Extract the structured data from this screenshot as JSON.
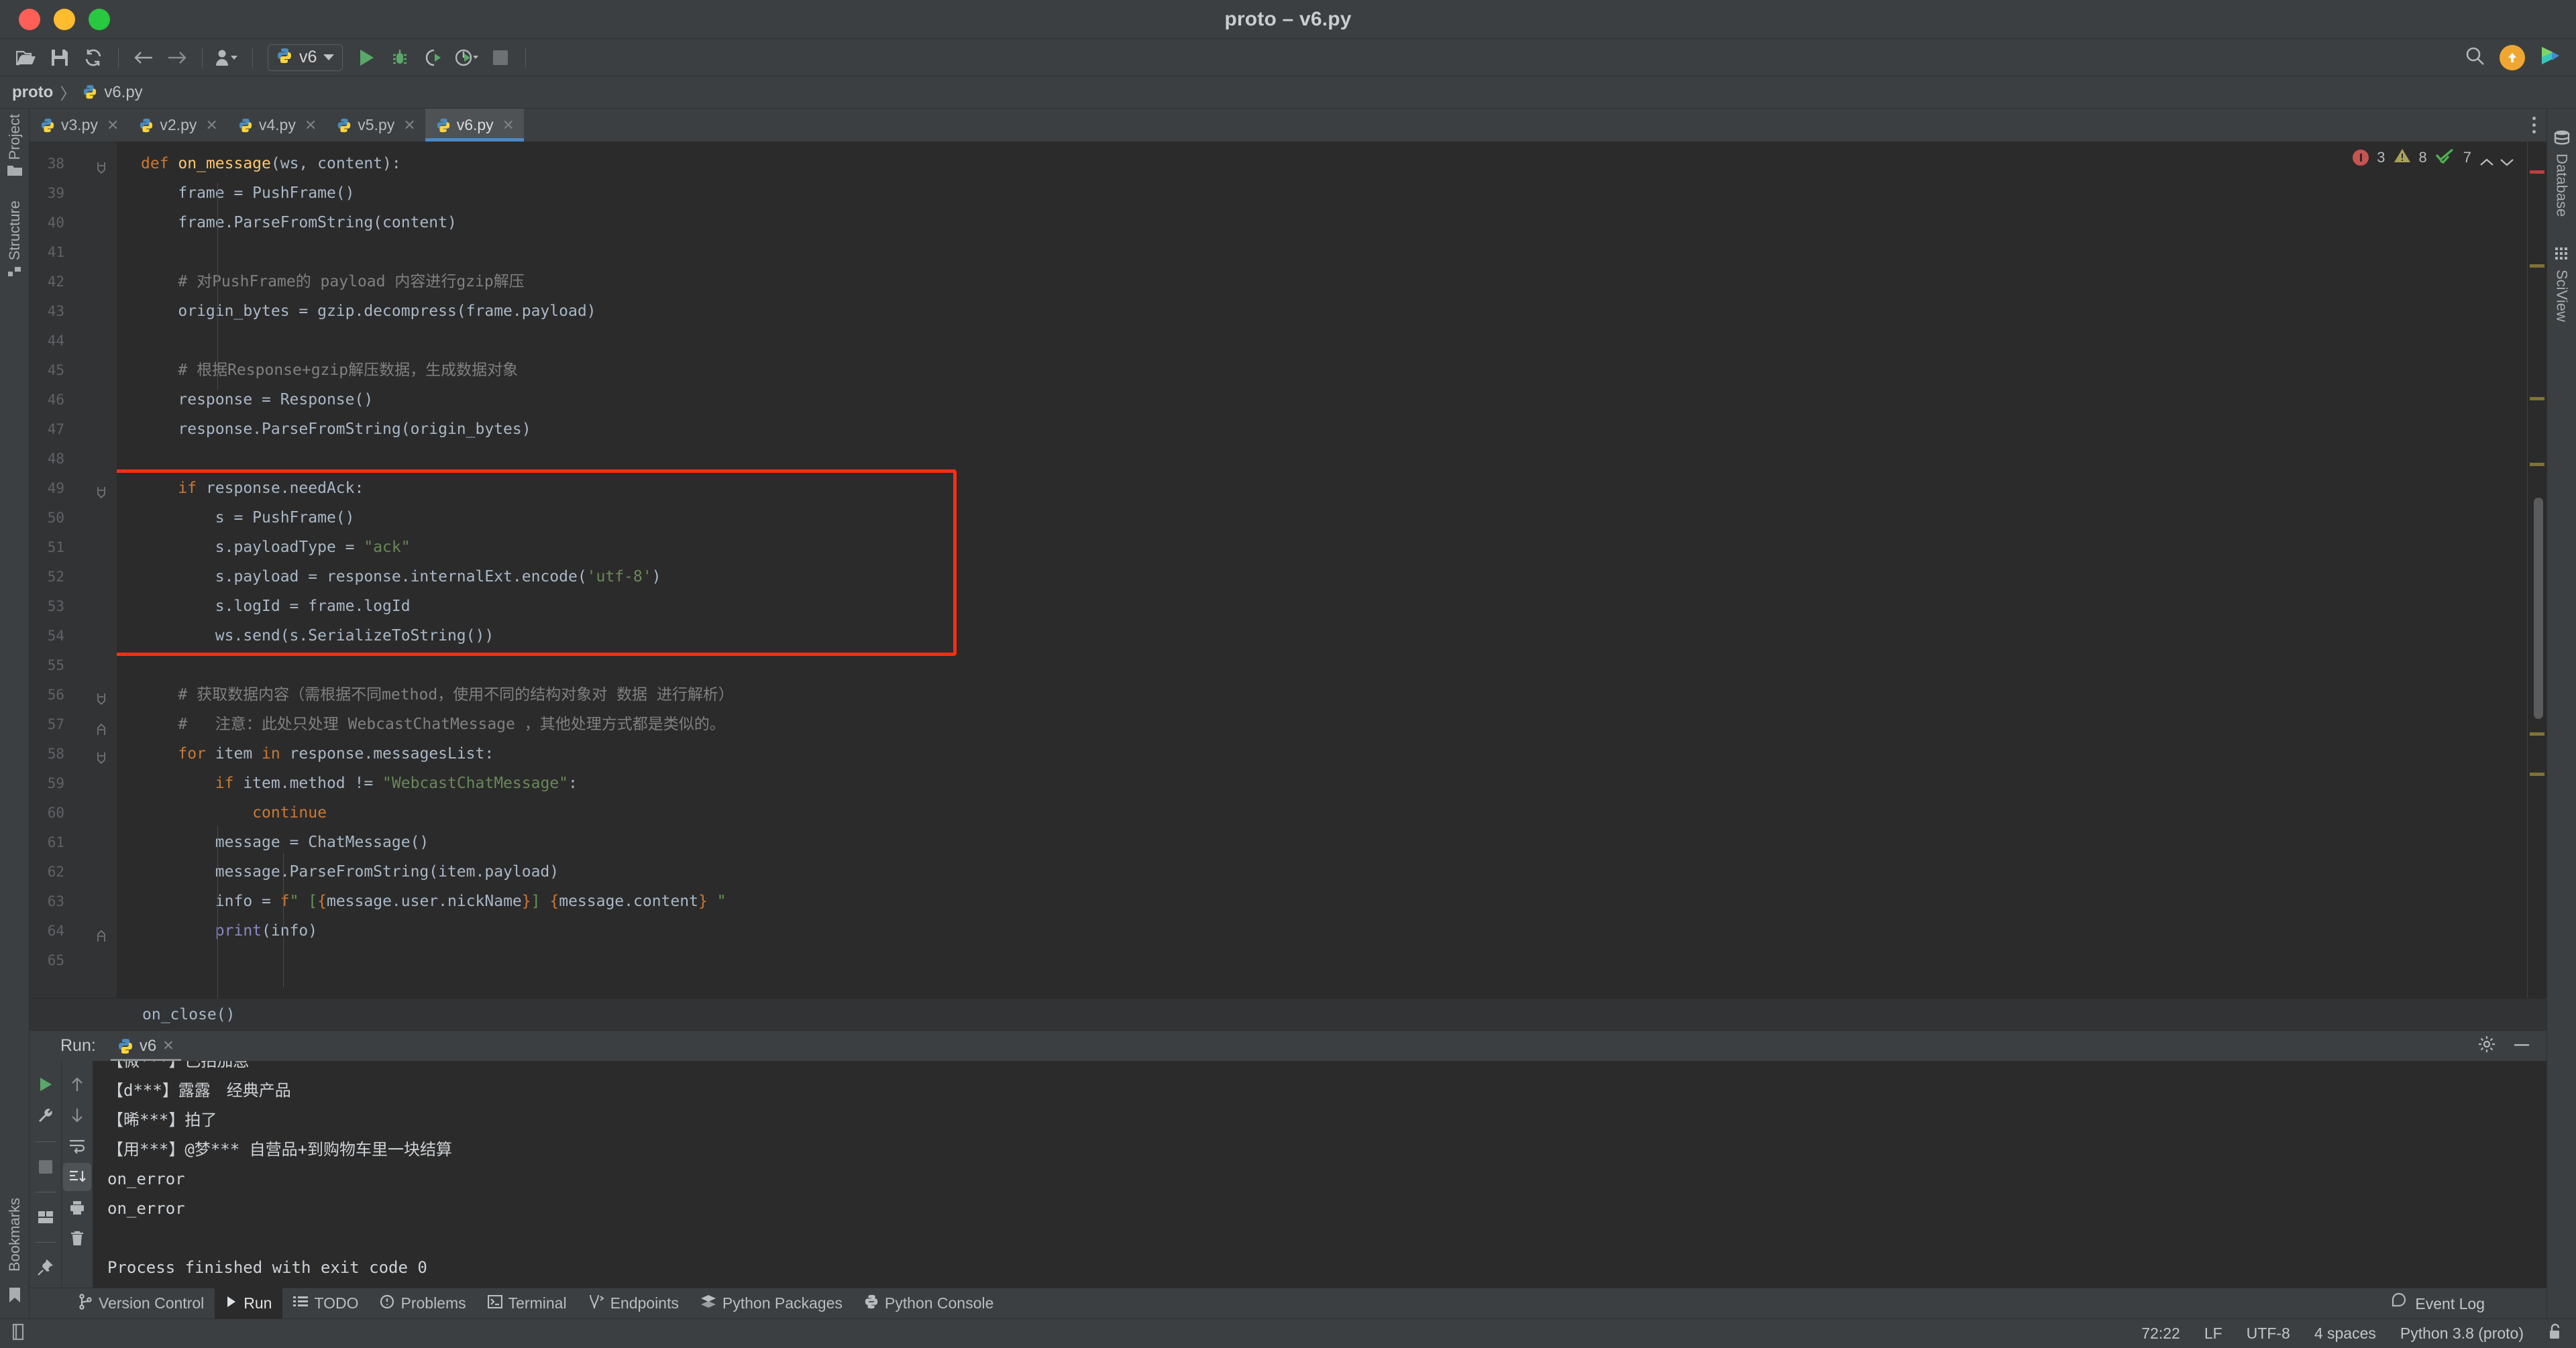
{
  "window": {
    "title": "proto – v6.py",
    "traffic_lights": [
      "close",
      "minimize",
      "zoom"
    ]
  },
  "toolbar": {
    "icons": [
      "open-folder-icon",
      "save-icon",
      "sync-icon",
      "back-arrow-icon",
      "forward-arrow-icon",
      "profiles-icon"
    ],
    "run_config": {
      "name": "v6",
      "icon": "python-file-icon"
    },
    "actions": [
      "run-icon",
      "debug-icon",
      "coverage-icon",
      "profile-icon",
      "stop-icon"
    ],
    "right": [
      "search-icon",
      "update-icon",
      "ai-assistant-icon"
    ]
  },
  "breadcrumb": {
    "project": "proto",
    "separator": "〉",
    "file": "v6.py"
  },
  "tabs": [
    {
      "label": "v3.py",
      "active": false
    },
    {
      "label": "v2.py",
      "active": false
    },
    {
      "label": "v4.py",
      "active": false
    },
    {
      "label": "v5.py",
      "active": false
    },
    {
      "label": "v6.py",
      "active": true
    }
  ],
  "editor": {
    "first_line": 38,
    "lines": [
      {
        "n": 38,
        "fold": "collapse",
        "html": "<span class=\"k\">def</span> <span class=\"fn\">on_message</span>(ws, content):"
      },
      {
        "n": 39,
        "fold": "",
        "html": "    frame = PushFrame()"
      },
      {
        "n": 40,
        "fold": "",
        "html": "    frame.ParseFromString(content)"
      },
      {
        "n": 41,
        "fold": "",
        "html": ""
      },
      {
        "n": 42,
        "fold": "",
        "html": "    <span class=\"c\"># 对PushFrame的 payload 内容进行gzip解压</span>"
      },
      {
        "n": 43,
        "fold": "",
        "html": "    origin_bytes = gzip.decompress(frame.payload)"
      },
      {
        "n": 44,
        "fold": "",
        "html": ""
      },
      {
        "n": 45,
        "fold": "",
        "html": "    <span class=\"c\"># 根据Response+gzip解压数据，生成数据对象</span>"
      },
      {
        "n": 46,
        "fold": "",
        "html": "    response = Response()"
      },
      {
        "n": 47,
        "fold": "",
        "html": "    response.ParseFromString(origin_bytes)"
      },
      {
        "n": 48,
        "fold": "",
        "html": ""
      },
      {
        "n": 49,
        "fold": "collapse",
        "html": "    <span class=\"k\">if</span> response.needAck:"
      },
      {
        "n": 50,
        "fold": "",
        "html": "        s = PushFrame()"
      },
      {
        "n": 51,
        "fold": "",
        "html": "        s.payloadType = <span class=\"s\">\"ack\"</span>"
      },
      {
        "n": 52,
        "fold": "",
        "html": "        s.payload = response.internalExt.encode(<span class=\"s\">'utf-8'</span>)"
      },
      {
        "n": 53,
        "fold": "",
        "html": "        s.logId = frame.logId"
      },
      {
        "n": 54,
        "fold": "",
        "html": "        ws.send(s.SerializeToString())"
      },
      {
        "n": 55,
        "fold": "",
        "html": ""
      },
      {
        "n": 56,
        "fold": "collapse",
        "html": "    <span class=\"c\"># 获取数据内容（需根据不同method，使用不同的结构对象对 数据 进行解析）</span>"
      },
      {
        "n": 57,
        "fold": "end",
        "html": "    <span class=\"c\">#   注意：此处只处理 WebcastChatMessage ，其他处理方式都是类似的。</span>"
      },
      {
        "n": 58,
        "fold": "collapse",
        "html": "    <span class=\"k\">for</span> item <span class=\"k\">in</span> response.messagesList:"
      },
      {
        "n": 59,
        "fold": "",
        "html": "        <span class=\"k\">if</span> item.method != <span class=\"s\">\"WebcastChatMessage\"</span>:"
      },
      {
        "n": 60,
        "fold": "",
        "html": "            <span class=\"k\">continue</span>"
      },
      {
        "n": 61,
        "fold": "",
        "html": "        message = ChatMessage()"
      },
      {
        "n": 62,
        "fold": "",
        "html": "        message.ParseFromString(item.payload)"
      },
      {
        "n": 63,
        "fold": "",
        "html": "        info = <span class=\"k\">f</span><span class=\"gl\">\" [</span><span class=\"br\">{</span>message.user.nickName<span class=\"br\">}</span><span class=\"gl\">]</span> <span class=\"br\">{</span>message.content<span class=\"br\">}</span> <span class=\"gl\">\"</span>"
      },
      {
        "n": 64,
        "fold": "end",
        "html": "        <span class=\"b\">print</span>(info)"
      },
      {
        "n": 65,
        "fold": "",
        "html": ""
      }
    ],
    "sticky_footer": "    on_close()",
    "highlight_box": {
      "from_line": 49,
      "to_line": 54,
      "color": "#ff2e12"
    },
    "inspections": {
      "errors": "3",
      "warnings": "8",
      "checks": "7"
    }
  },
  "run_panel": {
    "label": "Run:",
    "tab": {
      "name": "v6",
      "icon": "python-icon"
    },
    "gutter_left": [
      "rerun-icon",
      "wrench-icon",
      "stop-icon",
      "layout-icon",
      "pin-icon"
    ],
    "gutter_right": [
      "up-arrow-icon",
      "down-arrow-icon",
      "soft-wrap-icon",
      "scroll-to-end-icon",
      "print-icon",
      "trash-icon"
    ],
    "header_right": [
      "settings-gear-icon",
      "minimize-icon"
    ],
    "console_lines": [
      {
        "text": "【微***】已拍加急",
        "cut": true
      },
      {
        "text": "【d***】露露　经典产品",
        "cut": false
      },
      {
        "text": "【晞***】拍了",
        "cut": false
      },
      {
        "text": "【用***】@梦*** 自营品+到购物车里一块结算",
        "cut": false
      },
      {
        "text": "on_error",
        "cut": false
      },
      {
        "text": "on_error",
        "cut": false
      },
      {
        "text": "",
        "cut": false
      },
      {
        "text": "Process finished with exit code 0",
        "cut": false
      }
    ]
  },
  "tool_windows": [
    {
      "label": "Version Control",
      "icon": "branch-icon",
      "active": false
    },
    {
      "label": "Run",
      "icon": "play-icon",
      "active": true
    },
    {
      "label": "TODO",
      "icon": "list-icon",
      "active": false
    },
    {
      "label": "Problems",
      "icon": "problems-icon",
      "active": false
    },
    {
      "label": "Terminal",
      "icon": "terminal-icon",
      "active": false
    },
    {
      "label": "Endpoints",
      "icon": "endpoints-icon",
      "active": false
    },
    {
      "label": "Python Packages",
      "icon": "packages-icon",
      "active": false
    },
    {
      "label": "Python Console",
      "icon": "python-console-icon",
      "active": false
    }
  ],
  "left_rail": [
    {
      "label": "Project",
      "icon": "folder-icon"
    },
    {
      "label": "Structure",
      "icon": "structure-icon"
    },
    {
      "label": "Bookmarks",
      "icon": "bookmark-icon"
    }
  ],
  "right_rail": [
    {
      "label": "Database",
      "icon": "database-icon"
    },
    {
      "label": "SciView",
      "icon": "sciview-icon"
    }
  ],
  "event_log": {
    "label": "Event Log",
    "icon": "event-log-icon"
  },
  "status_bar": {
    "caret": "72:22",
    "line_ending": "LF",
    "encoding": "UTF-8",
    "indent": "4 spaces",
    "interpreter": "Python 3.8 (proto)",
    "lock_icon": "unlocked-icon"
  },
  "colors": {
    "accent_blue": "#4a88c7",
    "highlight_red": "#ff2e12",
    "keyword_orange": "#cc7832",
    "string_green": "#6a8759",
    "comment_gray": "#808080",
    "editor_bg": "#2b2b2b",
    "chrome_bg": "#3c3f41"
  }
}
